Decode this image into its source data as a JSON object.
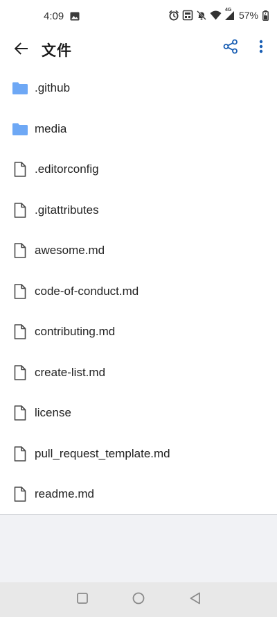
{
  "status_bar": {
    "time": "4:09",
    "battery_percent": "57%",
    "network": "4G",
    "icons": [
      "gallery-icon",
      "alarm-icon",
      "storage-icon",
      "bell-off-icon",
      "wifi-icon",
      "signal-icon",
      "battery-icon"
    ]
  },
  "app_bar": {
    "title": "文件",
    "back_icon": "arrow-left-icon",
    "share_icon": "share-icon",
    "more_icon": "more-vert-icon",
    "accent_color": "#1a5fb4"
  },
  "files": [
    {
      "name": ".github",
      "type": "folder"
    },
    {
      "name": "media",
      "type": "folder"
    },
    {
      "name": ".editorconfig",
      "type": "file"
    },
    {
      "name": ".gitattributes",
      "type": "file"
    },
    {
      "name": "awesome.md",
      "type": "file"
    },
    {
      "name": "code-of-conduct.md",
      "type": "file"
    },
    {
      "name": "contributing.md",
      "type": "file"
    },
    {
      "name": "create-list.md",
      "type": "file"
    },
    {
      "name": "license",
      "type": "file"
    },
    {
      "name": "pull_request_template.md",
      "type": "file"
    },
    {
      "name": "readme.md",
      "type": "file"
    }
  ],
  "colors": {
    "folder": "#6ea8f5",
    "file_outline": "#4a4a4a",
    "empty_background": "#f1f2f5",
    "nav_background": "#e8e8e8"
  },
  "nav_bar": {
    "buttons": [
      "recents-square-icon",
      "home-circle-icon",
      "back-triangle-icon"
    ]
  }
}
